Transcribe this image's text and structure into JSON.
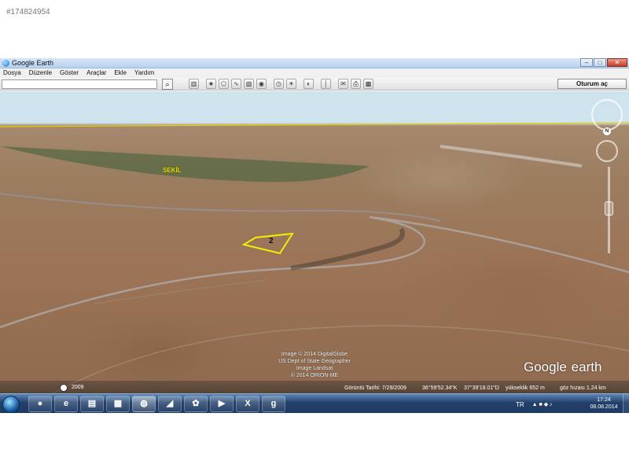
{
  "listing_id": "#174824954",
  "window": {
    "title": "Google Earth",
    "min": "–",
    "max": "□",
    "close": "✕"
  },
  "menu": [
    "Dosya",
    "Düzenle",
    "Göster",
    "Araçlar",
    "Ekle",
    "Yardım"
  ],
  "toolbar": {
    "search_icon": "search-icon",
    "signin_label": "Oturum aç"
  },
  "map": {
    "polygon_label": "2",
    "place_label": "SEKİL",
    "north_label": "N",
    "attribution": [
      "Image © 2014 DigitalGlobe",
      "US Dept of State Geographer",
      "Image Landsat",
      "© 2014 ORION-ME"
    ],
    "logo_main": "Google",
    "logo_sub": "earth"
  },
  "status": {
    "year": "2009",
    "imagery_date": "Görüntü Tarihi: 7/29/2009",
    "lat": "36°59'52.34\"K",
    "lon": "37°39'18.01\"D",
    "elevation": "yükseklik   652 m",
    "eye_alt": "göz hızası   1.24 km"
  },
  "taskbar": {
    "apps": [
      "●",
      "e",
      "▤",
      "▦",
      "◍",
      "◢",
      "✿",
      "▶",
      "X",
      "g"
    ],
    "lang": "TR",
    "tray_icons": "▲  ■  ◆  ♪",
    "time": "17:24",
    "date": "08.08.2014"
  }
}
